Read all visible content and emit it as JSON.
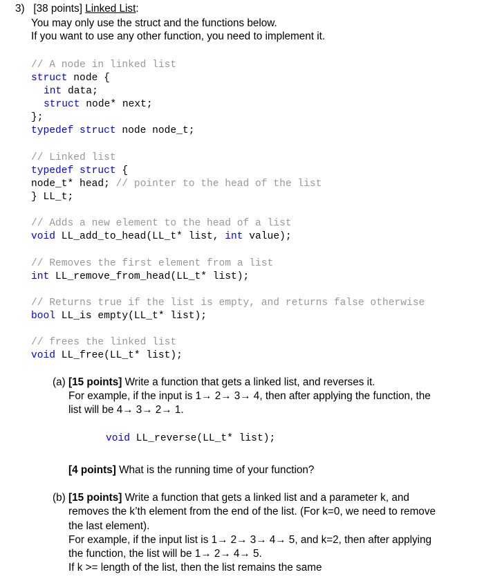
{
  "question": {
    "number": "3)",
    "points": "[38 points]",
    "title": "Linked List",
    "title_suffix": ":",
    "intro": [
      "You may only use the struct and the functions below.",
      "If you want to use any other function, you need to implement it."
    ]
  },
  "code": {
    "node_comment": "// A node in linked list",
    "node_struct_kw": "struct",
    "node_struct_rest": " node {",
    "field1_kw": "int",
    "field1_rest": " data;",
    "field2_kw": "struct",
    "field2_rest": " node* next;",
    "node_close": "};",
    "typedef_kw": "typedef struct",
    "typedef_rest": " node  node_t;",
    "ll_comment": "// Linked list",
    "ll_typedef_kw": "typedef struct",
    "ll_typedef_rest": " {",
    "head_field": "  node_t* head; ",
    "head_comment": "// pointer to the head of the list",
    "ll_close": "} LL_t;",
    "add_comment": "// Adds a new element to the head of a list",
    "add_ret": "void",
    "add_sig1": " LL_add_to_head(LL_t* list, ",
    "add_kw2": "int",
    "add_sig2": " value);",
    "remove_comment": "// Removes the first element from a list",
    "remove_ret": "int",
    "remove_sig": " LL_remove_from_head(LL_t* list);",
    "empty_comment": "// Returns true if the list is empty, and returns false otherwise",
    "empty_ret": "bool",
    "empty_sig": " LL_is empty(LL_t* list);",
    "free_comment": "// frees the linked list",
    "free_ret": "void",
    "free_sig": " LL_free(LL_t* list);"
  },
  "part_a": {
    "label": "(a)",
    "points": "[15 points]",
    "text": " Write a function that gets a linked list, and reverses it.",
    "example1": "For example, if the input is 1→ 2→ 3→ 4, then after applying the function, the",
    "example2": "list will be 4→ 3→ 2→ 1.",
    "sig_ret": "void",
    "sig_rest": " LL_reverse(LL_t* list);",
    "followup_points": "[4 points]",
    "followup_text": " What is the running time of your function?"
  },
  "part_b": {
    "label": "(b)",
    "points": "[15 points]",
    "lines": [
      " Write a function that gets a linked list and a parameter k, and",
      "removes the k’th element from the end of the list. (For k=0, we need to remove",
      "the last element).",
      "For example, if the input list is 1→ 2→ 3→ 4→ 5, and k=2, then after applying",
      "the function, the list will be 1→ 2→ 4→ 5.",
      "If k >= length of the list, then the list remains the same"
    ]
  }
}
